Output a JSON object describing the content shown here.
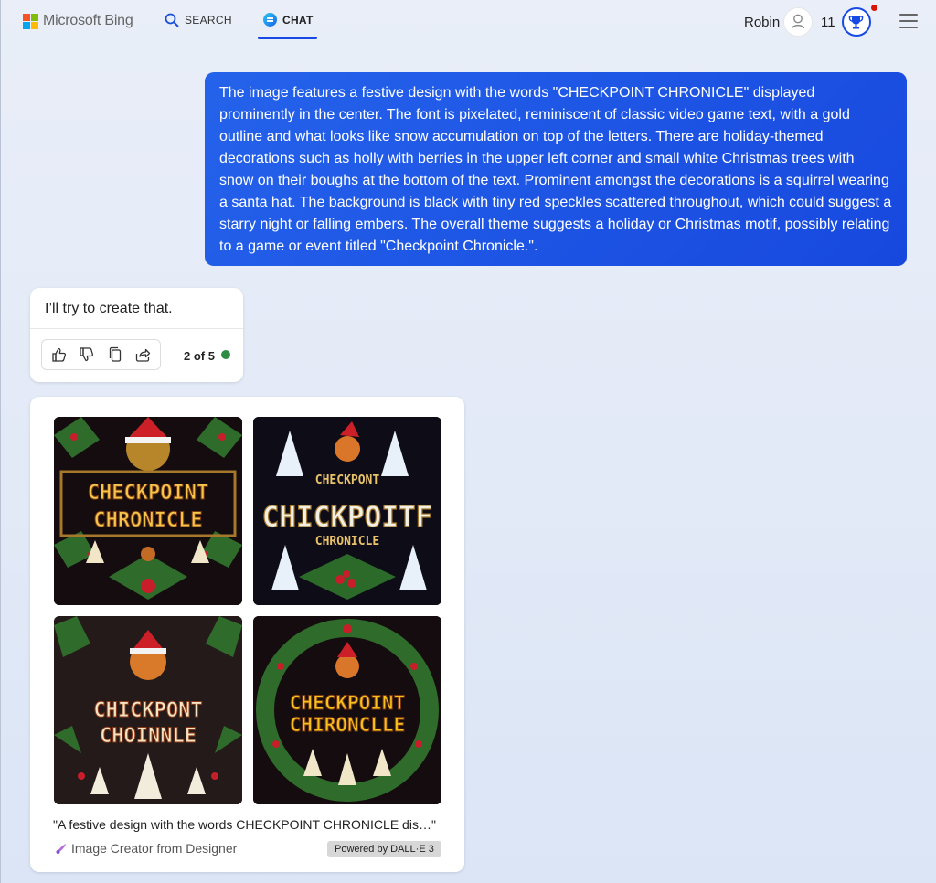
{
  "header": {
    "logo_text": "Microsoft Bing",
    "tabs": [
      {
        "label": "SEARCH",
        "icon": "search-icon",
        "active": false
      },
      {
        "label": "CHAT",
        "icon": "chat-bubble-icon",
        "active": true
      }
    ],
    "user_name": "Robin",
    "reward_points": "11",
    "accent_color": "#174ae4"
  },
  "conversation": {
    "user_message": "The image features a festive design with the words \"CHECKPOINT CHRONICLE\" displayed prominently in the center. The font is pixelated, reminiscent of classic video game text, with a gold outline and what looks like snow accumulation on top of the letters. There are holiday-themed decorations such as holly with berries in the upper left corner and small white Christmas trees with snow on their boughs at the bottom of the text. Prominent amongst the decorations is a squirrel wearing a santa hat. The background is black with tiny red speckles scattered throughout, which could suggest a starry night or falling embers. The overall theme suggests a holiday or Christmas motif, possibly relating to a game or event titled \"Checkpoint Chronicle.\".",
    "bot_reply": "I’ll try to create that.",
    "actions": [
      "thumbs-up-icon",
      "thumbs-down-icon",
      "copy-icon",
      "share-icon"
    ],
    "page_count": "2 of 5",
    "status_color": "#2e8b44"
  },
  "image_result": {
    "images": [
      {
        "line1": "CHECKPOINT",
        "line2": "CHRONICLE",
        "theme": "holly-wreath-gold"
      },
      {
        "line1": "CHECKPONT",
        "line2": "CHICKPOITF",
        "line3": "CHRONICLE",
        "theme": "snowy-trees-dark"
      },
      {
        "line1": "CHICKPONT",
        "line2": "CHOINNLE",
        "theme": "squirrel-snowflakes"
      },
      {
        "line1": "CHECKPOINT",
        "line2": "CHIRONCLLE",
        "theme": "round-wreath-yellow"
      }
    ],
    "caption": "\"A festive design with the words CHECKPOINT CHRONICLE dis…\"",
    "creator_label": "Image Creator from Designer",
    "powered_by": "Powered by DALL·E 3"
  }
}
